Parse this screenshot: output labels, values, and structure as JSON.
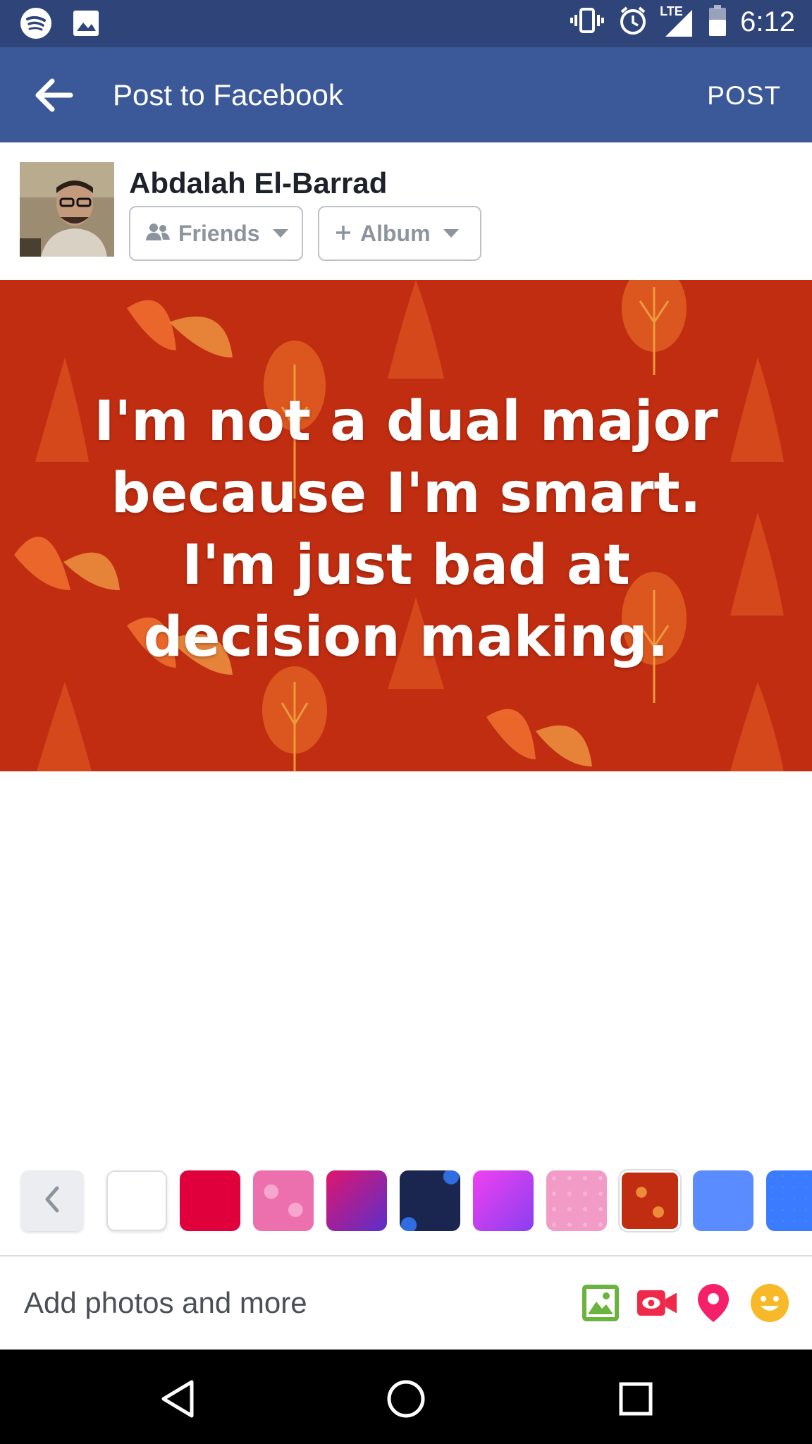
{
  "status_bar": {
    "time": "6:12",
    "network": "LTE",
    "left_icons": [
      "spotify-icon",
      "image-icon"
    ],
    "right_icons": [
      "vibrate-icon",
      "alarm-icon",
      "signal-icon",
      "battery-icon"
    ]
  },
  "header": {
    "title": "Post to Facebook",
    "post_label": "POST",
    "background": "#3b5998"
  },
  "composer": {
    "user_name": "Abdalah El-Barrad",
    "privacy_label": "Friends",
    "album_label": "Album"
  },
  "post": {
    "text": "I'm not a dual major because I'm smart. I'm just bad at decision making.",
    "background": "#c12d10"
  },
  "background_picker": {
    "swatches": [
      {
        "name": "white",
        "color": "#ffffff"
      },
      {
        "name": "red",
        "color": "#e0003c"
      },
      {
        "name": "pink-hearts",
        "color": "#ec6fae"
      },
      {
        "name": "magenta-purple-gradient",
        "color": "#8a2be2"
      },
      {
        "name": "dark-navy-pattern",
        "color": "#1a2650"
      },
      {
        "name": "purple-gradient",
        "color": "#c13ff0"
      },
      {
        "name": "pink-pattern",
        "color": "#f29bc6"
      },
      {
        "name": "autumn-leaves",
        "color": "#c12d10"
      },
      {
        "name": "blue",
        "color": "#5b8cff"
      },
      {
        "name": "blue-sparkle",
        "color": "#3a7bff"
      }
    ]
  },
  "add_bar": {
    "label": "Add photos and more",
    "icons": [
      "photo-icon",
      "live-video-icon",
      "location-pin-icon",
      "feeling-emoji-icon"
    ]
  },
  "nav_bar": {
    "buttons": [
      "back-triangle-icon",
      "home-circle-icon",
      "recents-square-icon"
    ]
  }
}
